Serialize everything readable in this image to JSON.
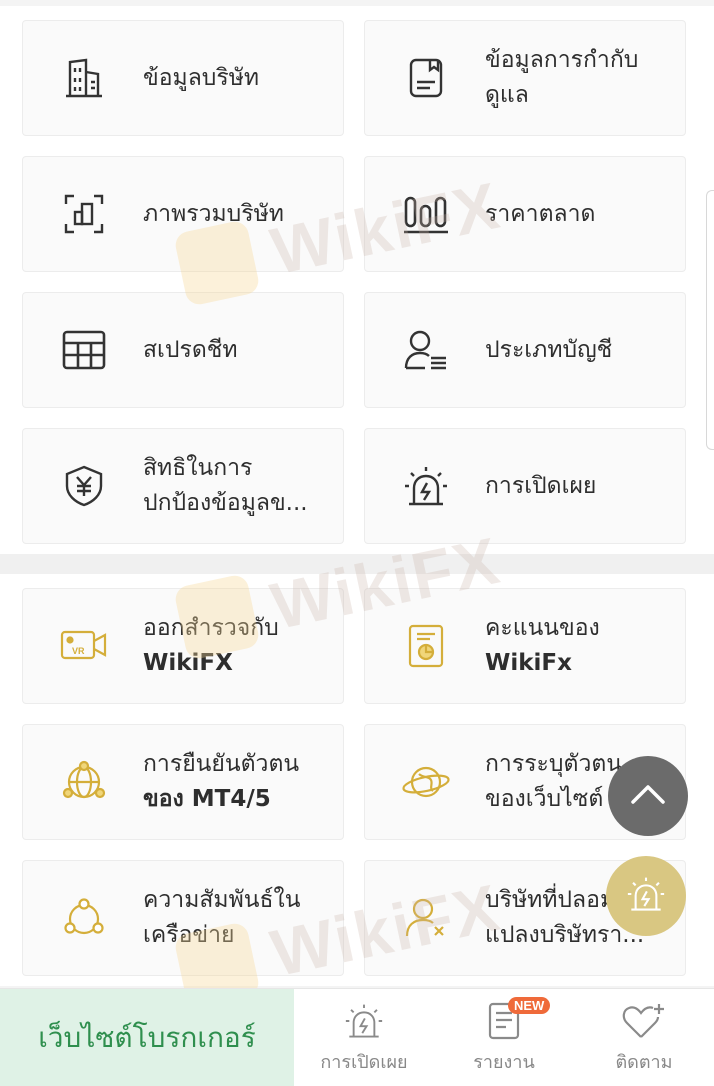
{
  "colors": {
    "accent_gold": "#d4ae3a",
    "dark_icon": "#333333",
    "broker_green": "#2f8f4e",
    "broker_bg": "#dff2e6",
    "badge": "#ef6a3a"
  },
  "section1": {
    "tiles": [
      {
        "label": "ข้อมูลบริษัท",
        "icon": "building-icon"
      },
      {
        "label": "ข้อมูลการกำกับ\nดูแล",
        "icon": "document-icon"
      },
      {
        "label": "ภาพรวมบริษัท",
        "icon": "overview-frame-icon"
      },
      {
        "label": "ราคาตลาด",
        "icon": "market-bars-icon"
      },
      {
        "label": "สเปรดชีท",
        "icon": "spreadsheet-icon"
      },
      {
        "label": "ประเภทบัญชี",
        "icon": "account-user-icon"
      },
      {
        "label": "สิทธิในการ\nปกป้องข้อมูลข...",
        "icon": "yen-shield-icon"
      },
      {
        "label": "การเปิดเผย",
        "icon": "alarm-icon"
      }
    ]
  },
  "section2": {
    "tiles": [
      {
        "label": "ออกสำรวจกับ",
        "label_bold": "WikiFX",
        "icon": "vr-camera-icon"
      },
      {
        "label": "คะแนนของ",
        "label_bold": "WikiFx",
        "icon": "score-report-icon"
      },
      {
        "label": "การยืนยันตัวตน",
        "label_bold": "ของ MT4/5",
        "icon": "network-globe-icon"
      },
      {
        "label": "การระบุตัวตน",
        "label_bold": "ของเว็บไซต์",
        "icon": "planet-icon"
      },
      {
        "label": "ความสัมพันธ์ใน\nเครือข่าย",
        "icon": "relation-network-icon"
      },
      {
        "label": "บริษัทที่ปลอม\nแปลงบริษัทรา...",
        "icon": "fake-user-icon"
      }
    ]
  },
  "watermark": "WikiFX",
  "bottom_bar": {
    "broker_button": "เว็บไซต์โบรกเกอร์",
    "disclosure_label": "การเปิดเผย",
    "report_label": "รายงาน",
    "report_badge": "NEW",
    "follow_label": "ติดตาม"
  }
}
